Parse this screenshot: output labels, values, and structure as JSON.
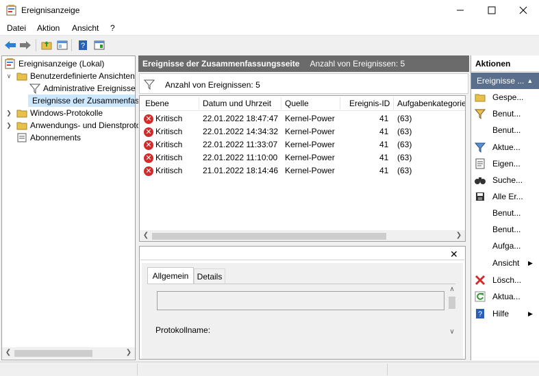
{
  "window": {
    "title": "Ereignisanzeige"
  },
  "menu": [
    "Datei",
    "Aktion",
    "Ansicht",
    "?"
  ],
  "tree": {
    "root": "Ereignisanzeige (Lokal)",
    "custom_views": "Benutzerdefinierte Ansichten",
    "admin_events": "Administrative Ereignisse",
    "summary_events": "Ereignisse der Zusammenfassungsseite",
    "windows_logs": "Windows-Protokolle",
    "app_logs": "Anwendungs- und Dienstprotokolle",
    "subscriptions": "Abonnements"
  },
  "center": {
    "header_title": "Ereignisse der Zusammenfassungsseite",
    "header_count": "Anzahl von Ereignissen: 5",
    "filter_count": "Anzahl von Ereignissen: 5",
    "columns": [
      "Ebene",
      "Datum und Uhrzeit",
      "Quelle",
      "Ereignis-ID",
      "Aufgabenkategorie"
    ],
    "rows": [
      {
        "level": "Kritisch",
        "datetime": "22.01.2022 18:47:47",
        "source": "Kernel-Power",
        "id": "41",
        "category": "(63)"
      },
      {
        "level": "Kritisch",
        "datetime": "22.01.2022 14:34:32",
        "source": "Kernel-Power",
        "id": "41",
        "category": "(63)"
      },
      {
        "level": "Kritisch",
        "datetime": "22.01.2022 11:33:07",
        "source": "Kernel-Power",
        "id": "41",
        "category": "(63)"
      },
      {
        "level": "Kritisch",
        "datetime": "22.01.2022 11:10:00",
        "source": "Kernel-Power",
        "id": "41",
        "category": "(63)"
      },
      {
        "level": "Kritisch",
        "datetime": "21.01.2022 18:14:46",
        "source": "Kernel-Power",
        "id": "41",
        "category": "(63)"
      }
    ],
    "detail_tabs": [
      "Allgemein",
      "Details"
    ],
    "detail_label": "Protokollname:"
  },
  "actions": {
    "header": "Aktionen",
    "section": "Ereignisse ...",
    "items": [
      "Gespe...",
      "Benut...",
      "Benut...",
      "Aktue...",
      "Eigen...",
      "Suche...",
      "Alle Er...",
      "Benut...",
      "Benut...",
      "Aufga...",
      "Ansicht",
      "Lösch...",
      "Aktua...",
      "Hilfe"
    ]
  },
  "colors": {
    "selection": "#cce8ff",
    "pane_header": "#6b6b6b",
    "critical": "#d12b2b"
  }
}
